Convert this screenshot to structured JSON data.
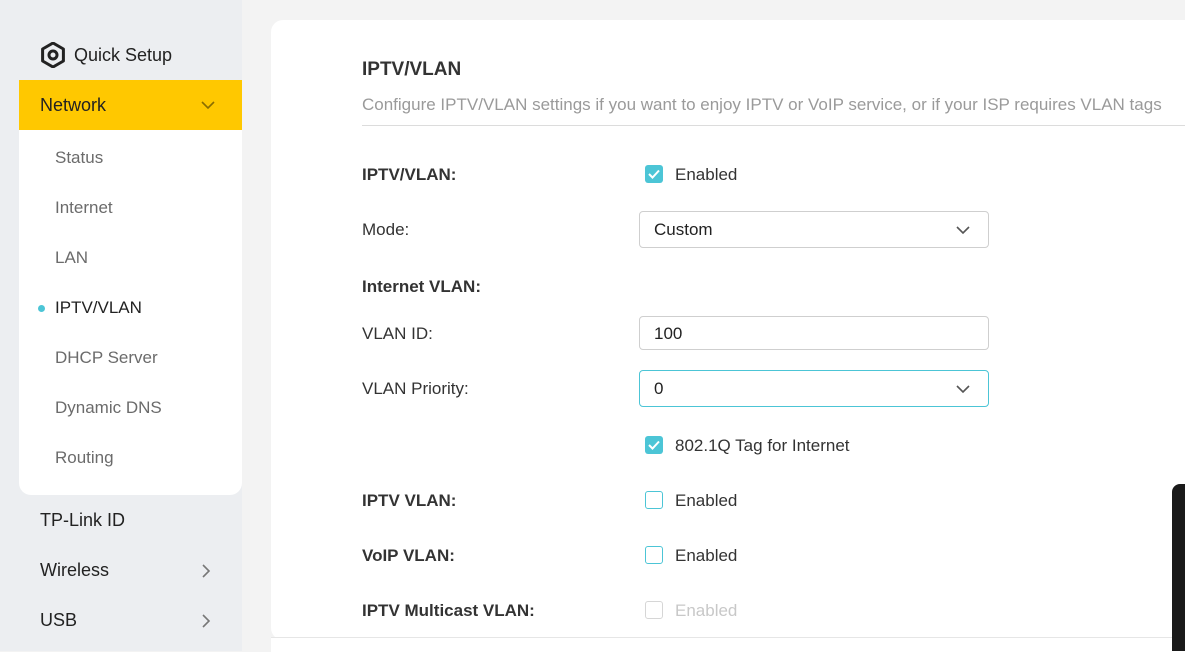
{
  "sidebar": {
    "quick_setup": "Quick Setup",
    "network": "Network",
    "network_items": [
      "Status",
      "Internet",
      "LAN",
      "IPTV/VLAN",
      "DHCP Server",
      "Dynamic DNS",
      "Routing"
    ],
    "active_item": "IPTV/VLAN",
    "other_items": [
      "TP-Link ID",
      "Wireless",
      "USB"
    ]
  },
  "main": {
    "title": "IPTV/VLAN",
    "description": "Configure IPTV/VLAN settings if you want to enjoy IPTV or VoIP service, or if your ISP requires VLAN tags",
    "iptv_vlan_label": "IPTV/VLAN:",
    "iptv_vlan_enabled": "Enabled",
    "mode_label": "Mode:",
    "mode_value": "Custom",
    "internet_vlan_label": "Internet VLAN:",
    "vlan_id_label": "VLAN ID:",
    "vlan_id_value": "100",
    "vlan_priority_label": "VLAN Priority:",
    "vlan_priority_value": "0",
    "tag_label": "802.1Q Tag for Internet",
    "iptv_vlan2_label": "IPTV VLAN:",
    "iptv_vlan2_enabled": "Enabled",
    "voip_vlan_label": "VoIP VLAN:",
    "voip_vlan_enabled": "Enabled",
    "multicast_label": "IPTV Multicast VLAN:",
    "multicast_enabled": "Enabled"
  },
  "colors": {
    "accent": "#4cc5d6",
    "nav_highlight": "#ffc800"
  }
}
